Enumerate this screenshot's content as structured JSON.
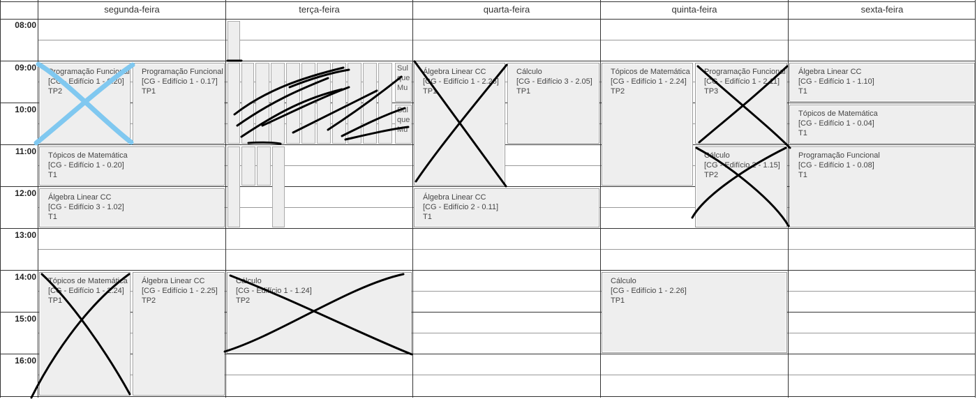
{
  "days": [
    "segunda-feira",
    "terça-feira",
    "quarta-feira",
    "quinta-feira",
    "sexta-feira"
  ],
  "times": [
    "08:00",
    "09:00",
    "10:00",
    "11:00",
    "12:00",
    "13:00",
    "14:00",
    "15:00",
    "16:00"
  ],
  "events": {
    "seg_prog": {
      "title": "Programação Funcional",
      "room": "[CG - Edifício 1 - 0.20]",
      "type": "TP2"
    },
    "seg_prog2": {
      "title": "Programação Funcional",
      "room": "[CG - Edifício 1 - 0.17]",
      "type": "TP1"
    },
    "seg_top": {
      "title": "Tópicos de Matemática",
      "room": "[CG - Edifício 1 - 0.20]",
      "type": "T1"
    },
    "seg_alg": {
      "title": "Álgebra Linear CC",
      "room": "[CG - Edifício 3 - 1.02]",
      "type": "T1"
    },
    "seg_top2": {
      "title": "Tópicos de Matemática",
      "room": "[CG - Edifício 1 - 2.24]",
      "type": "TP1"
    },
    "seg_alg2": {
      "title": "Álgebra Linear CC",
      "room": "[CG - Edifício 1 - 2.25]",
      "type": "TP2"
    },
    "ter_calc": {
      "title": "Cálculo",
      "room": "[CG - Edifício 1 - 1.24]",
      "type": "TP2"
    },
    "ter_sul1": {
      "title": "Sul",
      "line2": "que",
      "line3": "Mu"
    },
    "ter_sul2": {
      "title": "Sul",
      "line2": "que",
      "line3": "Mu"
    },
    "qua_alg": {
      "title": "Álgebra Linear CC",
      "room": "[CG - Edifício 1 - 2.26]",
      "type": "TP1"
    },
    "qua_calc": {
      "title": "Cálculo",
      "room": "[CG - Edifício 3 - 2.05]",
      "type": "TP1"
    },
    "qua_alg2": {
      "title": "Álgebra Linear CC",
      "room": "[CG - Edifício 2 - 0.11]",
      "type": "T1"
    },
    "qui_top": {
      "title": "Tópicos de Matemática",
      "room": "[CG - Edifício 1 - 2.24]",
      "type": "TP2"
    },
    "qui_prog": {
      "title": "Programação Funcional",
      "room": "[CG - Edifício 1 - 2.11]",
      "type": "TP3"
    },
    "qui_calc": {
      "title": "Cálculo",
      "room": "[CG - Edifício 2 - 1.15]",
      "type": "TP2"
    },
    "qui_calc2": {
      "title": "Cálculo",
      "room": "[CG - Edifício 1 - 2.26]",
      "type": "TP1"
    },
    "sex_alg": {
      "title": "Álgebra Linear CC",
      "room": "[CG - Edifício 1 - 1.10]",
      "type": "T1"
    },
    "sex_top": {
      "title": "Tópicos de Matemática",
      "room": "[CG - Edifício 1 - 0.04]",
      "type": "T1"
    },
    "sex_prog": {
      "title": "Programação Funcional",
      "room": "[CG - Edifício 1 - 0.08]",
      "type": "T1"
    }
  },
  "colors": {
    "event_bg": "#eeeeee",
    "cross_black": "#000000",
    "cross_blue": "#80c8f0"
  }
}
